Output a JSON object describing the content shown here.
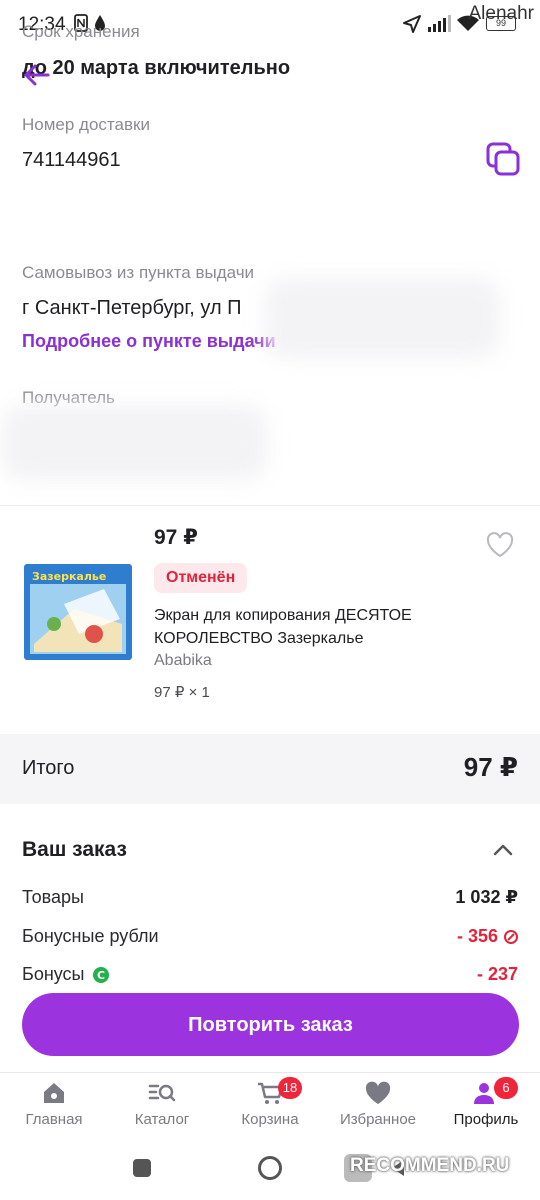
{
  "status_bar": {
    "time": "12:34",
    "battery": "99",
    "watermark_user": "Alenahr"
  },
  "storage": {
    "label": "Срок хранения",
    "value": "до 20 марта включительно"
  },
  "delivery": {
    "label": "Номер доставки",
    "number": "741144961"
  },
  "pickup": {
    "label": "Самовывоз из пункта выдачи",
    "address": "г Санкт-Петербург, ул П",
    "link": "Подробнее о пункте выдачи"
  },
  "recipient": {
    "label": "Получатель"
  },
  "product": {
    "price": "97 ₽",
    "status": "Отменён",
    "name": "Экран для копирования ДЕСЯТОЕ КОРОЛЕВСТВО Зазеркалье",
    "brand": "Ababika",
    "qty": "97 ₽ × 1",
    "image_text": "Зазеркалье"
  },
  "total": {
    "label": "Итого",
    "value": "97 ₽"
  },
  "order": {
    "title": "Ваш заказ",
    "rows": [
      {
        "label": "Товары",
        "value": "1 032 ₽"
      },
      {
        "label": "Бонусные рубли",
        "value": "- 356"
      },
      {
        "label": "Бонусы",
        "value": "- 237"
      }
    ]
  },
  "repeat_button": "Повторить заказ",
  "nav": [
    {
      "label": "Главная",
      "icon": "home-icon"
    },
    {
      "label": "Каталог",
      "icon": "catalog-search-icon"
    },
    {
      "label": "Корзина",
      "icon": "cart-icon",
      "badge": "18"
    },
    {
      "label": "Избранное",
      "icon": "heart-icon"
    },
    {
      "label": "Профиль",
      "icon": "profile-icon",
      "badge": "6"
    }
  ],
  "watermark_site": "RECOMMEND.RU",
  "colors": {
    "accent": "#9b34df",
    "danger": "#e0243b",
    "badge_bg": "#fde8ec"
  }
}
